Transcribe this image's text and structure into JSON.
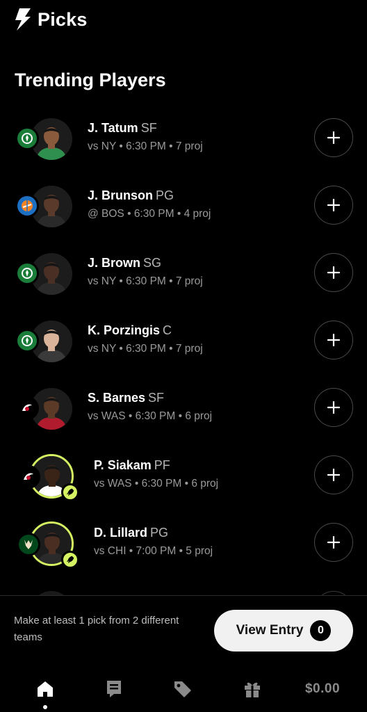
{
  "header": {
    "title": "Picks",
    "logo_icon": "bolt-icon"
  },
  "section_title": "Trending Players",
  "players": [
    {
      "name": "J. Tatum",
      "pos": "SF",
      "meta": "vs NY • 6:30 PM • 7 proj",
      "team": "celtics",
      "team_color": "#1a7d3a",
      "skin": "#8a5a3c",
      "shirt": "#2f8f4e",
      "special": false
    },
    {
      "name": "J. Brunson",
      "pos": "PG",
      "meta": "@ BOS • 6:30 PM • 4 proj",
      "team": "knicks",
      "team_color": "#1d6fc2",
      "skin": "#5a3a2a",
      "shirt": "#2a2a2a",
      "special": false
    },
    {
      "name": "J. Brown",
      "pos": "SG",
      "meta": "vs NY • 6:30 PM • 7 proj",
      "team": "celtics",
      "team_color": "#1a7d3a",
      "skin": "#4a3024",
      "shirt": "#2a2a2a",
      "special": false
    },
    {
      "name": "K. Porzingis",
      "pos": "C",
      "meta": "vs NY • 6:30 PM • 7 proj",
      "team": "celtics",
      "team_color": "#1a7d3a",
      "skin": "#d9b49a",
      "shirt": "#3a3a3a",
      "special": false
    },
    {
      "name": "S. Barnes",
      "pos": "SF",
      "meta": "vs WAS • 6:30 PM • 6 proj",
      "team": "raptors",
      "team_color": "#c8102e",
      "skin": "#5c3a28",
      "shirt": "#b01c2e",
      "special": false
    },
    {
      "name": "P. Siakam",
      "pos": "PF",
      "meta": "vs WAS • 6:30 PM • 6 proj",
      "team": "raptors",
      "team_color": "#c8102e",
      "skin": "#3a2418",
      "shirt": "#ffffff",
      "special": true
    },
    {
      "name": "D. Lillard",
      "pos": "PG",
      "meta": "vs CHI • 7:00 PM • 5 proj",
      "team": "bucks",
      "team_color": "#00471b",
      "skin": "#4a2e22",
      "shirt": "#2a2a2a",
      "special": true
    }
  ],
  "footer": {
    "hint": "Make at least 1 pick from 2 different teams",
    "view_entry_label": "View Entry",
    "entry_count": "0"
  },
  "tabs": [
    {
      "name": "home",
      "icon": "home-icon",
      "active": true
    },
    {
      "name": "entries",
      "icon": "receipt-icon",
      "active": false
    },
    {
      "name": "promos",
      "icon": "tag-icon",
      "active": false
    },
    {
      "name": "rewards",
      "icon": "gift-icon",
      "active": false
    },
    {
      "name": "wallet",
      "label": "$0.00",
      "active": false
    }
  ],
  "colors": {
    "boost": "#d4f262",
    "background": "#000000"
  }
}
